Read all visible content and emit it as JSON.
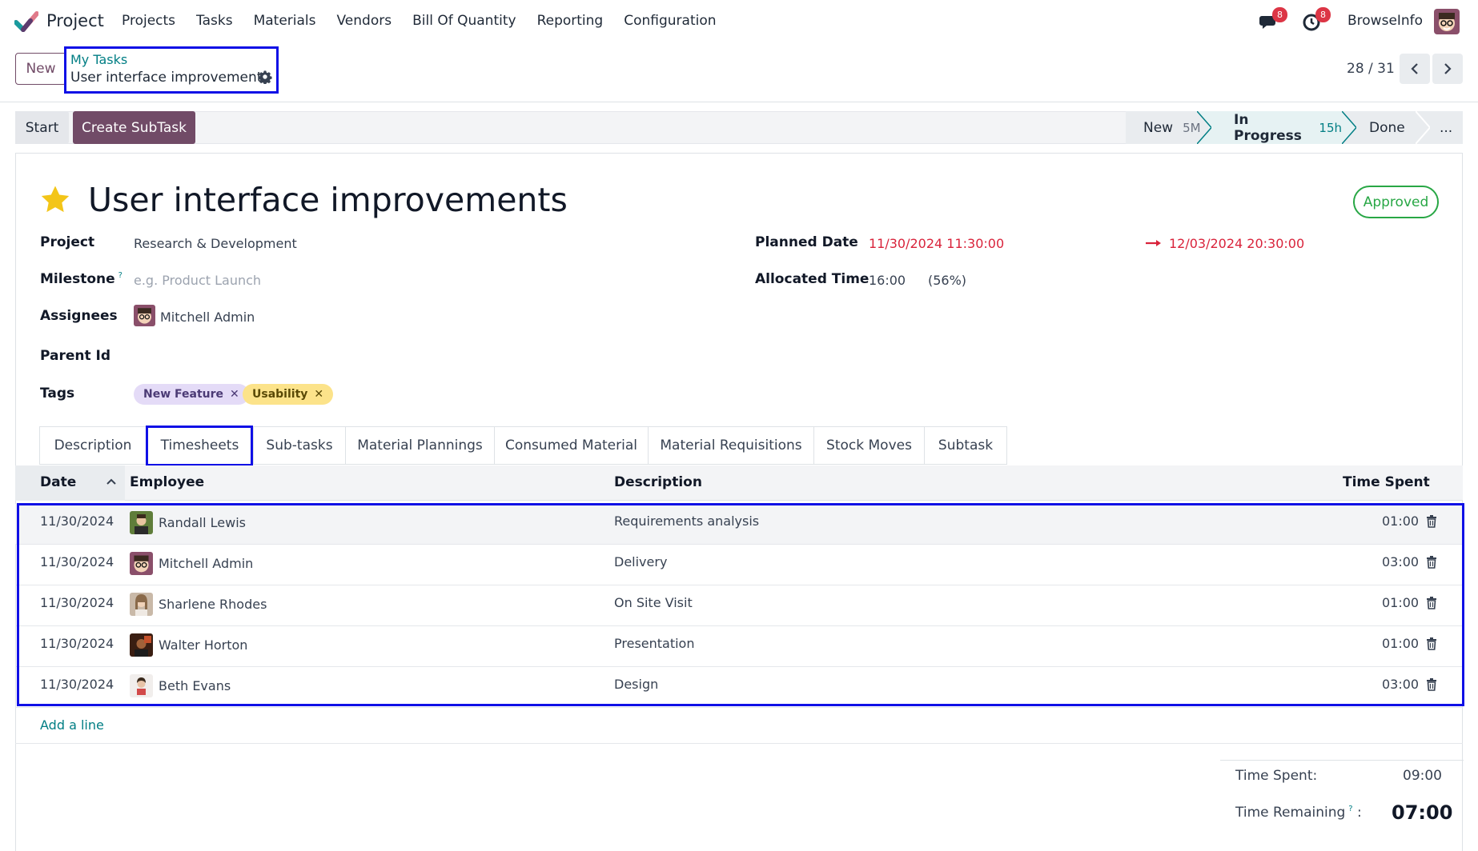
{
  "navbar": {
    "app_name": "Project",
    "menu": [
      "Projects",
      "Tasks",
      "Materials",
      "Vendors",
      "Bill Of Quantity",
      "Reporting",
      "Configuration"
    ],
    "messages_badge": "8",
    "activities_badge": "8",
    "company": "BrowseInfo"
  },
  "control": {
    "new_label": "New",
    "breadcrumb_parent": "My Tasks",
    "breadcrumb_current": "User interface improvements",
    "pager_value": "28 / 31"
  },
  "actions": {
    "start_label": "Start",
    "create_subtask_label": "Create SubTask"
  },
  "stages": [
    {
      "label": "New",
      "sub": "5M",
      "active": false
    },
    {
      "label": "In Progress",
      "sub": "15h",
      "active": true
    },
    {
      "label": "Done",
      "sub": "",
      "active": false
    },
    {
      "label": "...",
      "sub": "",
      "active": false
    }
  ],
  "form": {
    "title": "User interface improvements",
    "status_badge": "Approved",
    "project_label": "Project",
    "project_value": "Research & Development",
    "milestone_label": "Milestone",
    "milestone_help": "?",
    "milestone_placeholder": "e.g. Product Launch",
    "assignees_label": "Assignees",
    "assignee_name": "Mitchell Admin",
    "parent_label": "Parent Id",
    "tags_label": "Tags",
    "tags": [
      "New Feature",
      "Usability"
    ],
    "planned_date_label": "Planned Date",
    "planned_start": "11/30/2024 11:30:00",
    "planned_end": "12/03/2024 20:30:00",
    "allocated_label": "Allocated Time",
    "allocated_value": "16:00",
    "allocated_pct": "(56%)"
  },
  "tabs": [
    "Description",
    "Timesheets",
    "Sub-tasks",
    "Material Plannings",
    "Consumed Material",
    "Material Requisitions",
    "Stock Moves",
    "Subtask"
  ],
  "timesheet": {
    "columns": {
      "date": "Date",
      "employee": "Employee",
      "description": "Description",
      "time_spent": "Time Spent"
    },
    "rows": [
      {
        "date": "11/30/2024",
        "employee": "Randall Lewis",
        "description": "Requirements analysis",
        "time": "01:00"
      },
      {
        "date": "11/30/2024",
        "employee": "Mitchell Admin",
        "description": "Delivery",
        "time": "03:00"
      },
      {
        "date": "11/30/2024",
        "employee": "Sharlene Rhodes",
        "description": "On Site Visit",
        "time": "01:00"
      },
      {
        "date": "11/30/2024",
        "employee": "Walter Horton",
        "description": "Presentation",
        "time": "01:00"
      },
      {
        "date": "11/30/2024",
        "employee": "Beth Evans",
        "description": "Design",
        "time": "03:00"
      }
    ],
    "add_line": "Add a line"
  },
  "totals": {
    "time_spent_label": "Time Spent:",
    "time_spent_value": "09:00",
    "remaining_label": "Time Remaining",
    "remaining_help": "?",
    "remaining_colon": ":",
    "remaining_value": "07:00"
  },
  "colors": {
    "brand": "#714b67",
    "link": "#017e84",
    "danger": "#d9233b",
    "success": "#28a745",
    "highlight": "#1010e6"
  },
  "icons": [
    "checkmark-logo-icon",
    "chat-icon",
    "clock-icon",
    "gear-icon",
    "chevron-left-icon",
    "chevron-right-icon",
    "star-icon",
    "arrow-right-icon",
    "sort-up-icon",
    "trash-icon",
    "close-icon"
  ]
}
